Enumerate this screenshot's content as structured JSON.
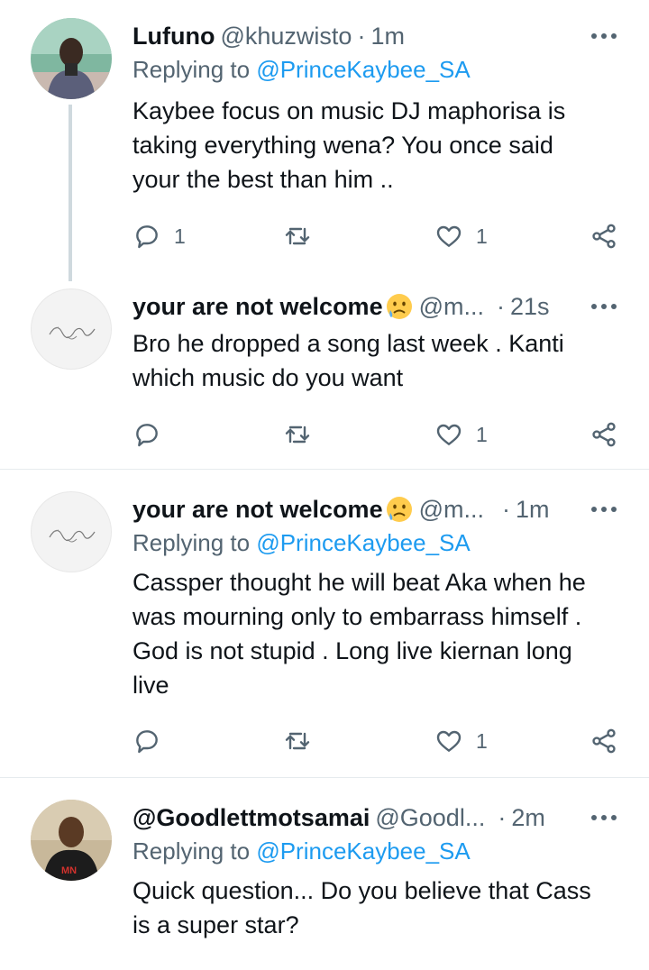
{
  "tweets": [
    {
      "name": "Lufuno",
      "handle": "@khuzwisto",
      "time": "1m",
      "replying_prefix": "Replying to ",
      "replying_to": "@PrinceKaybee_SA",
      "text": "Kaybee  focus  on music DJ maphorisa is\ntaking  everything  wena?  You once  said\nyour the best than him ..",
      "reply_count": "1",
      "retweet_count": "",
      "like_count": "1",
      "avatar_icon": "user-photo-avatar"
    },
    {
      "name": "your are not welcome",
      "handle": "@m...",
      "time": "21s",
      "replying_prefix": "",
      "replying_to": "",
      "text": "Bro he dropped a song last week . Kanti\nwhich music do you want",
      "reply_count": "",
      "retweet_count": "",
      "like_count": "1",
      "avatar_icon": "signature-avatar"
    },
    {
      "name": "your are not welcome",
      "handle": "@m...",
      "time": "1m",
      "replying_prefix": "Replying to ",
      "replying_to": "@PrinceKaybee_SA",
      "text": "Cassper thought he will beat Aka when he\nwas mourning only to embarrass himself .\nGod is not stupid . Long live kiernan long\nlive",
      "reply_count": "",
      "retweet_count": "",
      "like_count": "1",
      "avatar_icon": "signature-avatar"
    },
    {
      "name": "@Goodlettmotsamai",
      "handle": "@Goodl...",
      "time": "2m",
      "replying_prefix": "Replying to ",
      "replying_to": "@PrinceKaybee_SA",
      "text": "Quick question... Do you believe that Cass\nis a super star?",
      "avatar_icon": "user-photo-avatar"
    }
  ],
  "colors": {
    "link": "#1d9bf0",
    "secondary_text": "#536471",
    "divider": "#e6ebee",
    "thread_line": "#cfd9de"
  }
}
